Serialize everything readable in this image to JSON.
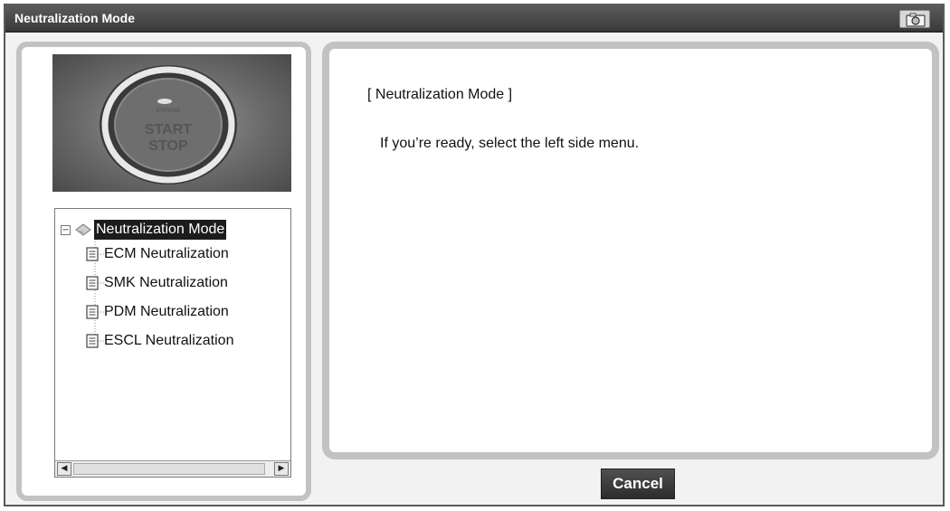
{
  "window": {
    "title": "Neutralization Mode"
  },
  "hero": {
    "button_text_line1": "START",
    "button_text_line2": "STOP"
  },
  "tree": {
    "root_label": "Neutralization Mode",
    "items": [
      {
        "label": "ECM Neutralization"
      },
      {
        "label": "SMK Neutralization"
      },
      {
        "label": "PDM Neutralization"
      },
      {
        "label": "ESCL Neutralization"
      }
    ]
  },
  "content": {
    "heading": "[ Neutralization Mode ]",
    "message": "If you’re ready, select the left side menu."
  },
  "footer": {
    "cancel_label": "Cancel"
  },
  "colors": {
    "titlebar": "#3a3a3a",
    "panel_border": "#c2c2c2",
    "selected_bg": "#1c1c1c",
    "button_bg": "#2c2c2c"
  }
}
